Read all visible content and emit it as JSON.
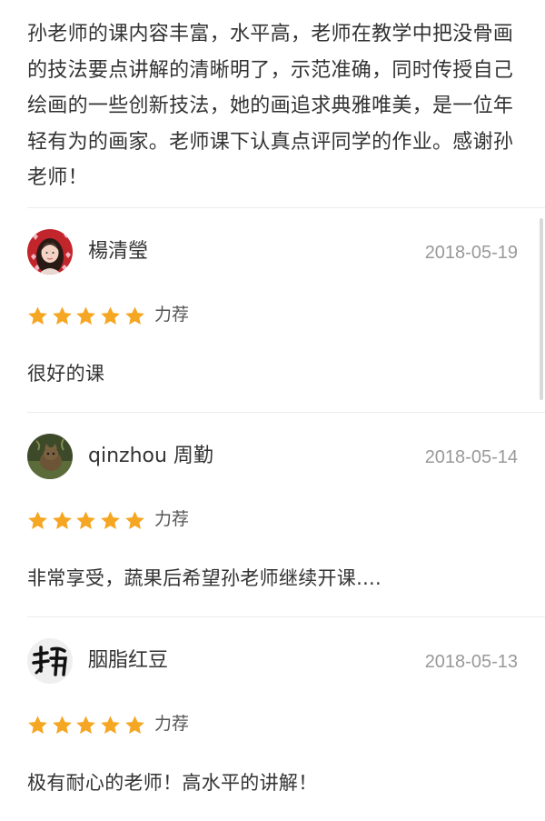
{
  "top_review": {
    "text": "孙老师的课内容丰富，水平高，老师在教学中把没骨画的技法要点讲解的清晰明了，示范准确，同时传授自己绘画的一些创新技法，她的画追求典雅唯美，是一位年轻有为的画家。老师课下认真点评同学的作业。感谢孙老师！"
  },
  "reviews": [
    {
      "username": "楊清瑩",
      "date": "2018-05-19",
      "stars": 5,
      "rating_label": "力荐",
      "comment": "很好的课",
      "avatar_icon": "user-photo-girl"
    },
    {
      "username": "qinzhou 周勤",
      "date": "2018-05-14",
      "stars": 5,
      "rating_label": "力荐",
      "comment": "非常享受，蔬果后希望孙老师继续开课....",
      "avatar_icon": "user-photo-cat"
    },
    {
      "username": "胭脂红豆",
      "date": "2018-05-13",
      "stars": 5,
      "rating_label": "力荐",
      "comment": "极有耐心的老师！高水平的讲解！",
      "avatar_icon": "user-photo-calligraphy"
    }
  ],
  "colors": {
    "star": "#f5a623",
    "date": "#999999",
    "divider": "#ececec"
  }
}
